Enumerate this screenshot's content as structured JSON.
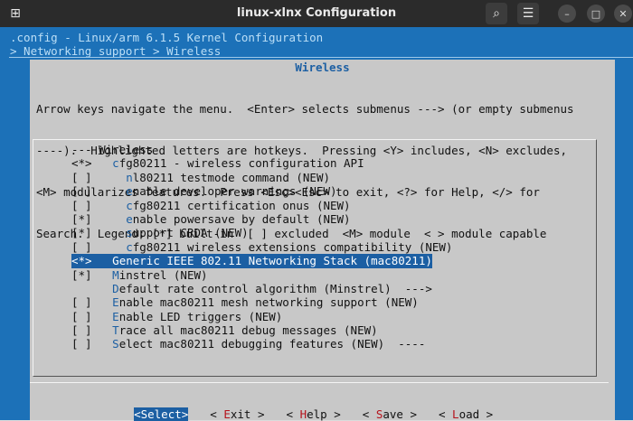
{
  "window": {
    "title": "linux-xlnx Configuration",
    "new_tab_glyph": "⊞",
    "search_glyph": "⌕",
    "menu_glyph": "☰",
    "minimize_glyph": "–",
    "maximize_glyph": "□",
    "close_glyph": "✕"
  },
  "header": {
    "line1": ".config - Linux/arm 6.1.5 Kernel Configuration",
    "line2": "> Networking support > Wireless"
  },
  "dialog": {
    "title": "Wireless",
    "help_lines": [
      "Arrow keys navigate the menu.  <Enter> selects submenus ---> (or empty submenus",
      "----).  Highlighted letters are hotkeys.  Pressing <Y> includes, <N> excludes,",
      "<M> modularizes features.  Press <Esc><Esc> to exit, <?> for Help, </> for",
      "Search.  Legend: [*] built-in  [ ] excluded  <M> module  < > module capable"
    ]
  },
  "menu": {
    "items": [
      {
        "pre": "--- Wireless",
        "hk": "",
        "post": ""
      },
      {
        "pre": "<*>   ",
        "hk": "c",
        "post": "fg80211 - wireless configuration API"
      },
      {
        "pre": "[ ]     ",
        "hk": "n",
        "post": "l80211 testmode command (NEW)"
      },
      {
        "pre": "[ ]     ",
        "hk": "e",
        "post": "nable developer warnings (NEW)"
      },
      {
        "pre": "[ ]     ",
        "hk": "c",
        "post": "fg80211 certification onus (NEW)"
      },
      {
        "pre": "[*]     ",
        "hk": "e",
        "post": "nable powersave by default (NEW)"
      },
      {
        "pre": "[*]     ",
        "hk": "s",
        "post": "upport CRDA (NEW)"
      },
      {
        "pre": "[ ]     ",
        "hk": "c",
        "post": "fg80211 wireless extensions compatibility (NEW)"
      },
      {
        "pre": "<*>   ",
        "hk": "G",
        "post": "eneric IEEE 802.11 Networking Stack (mac80211)"
      },
      {
        "pre": "[*]   ",
        "hk": "M",
        "post": "instrel (NEW)"
      },
      {
        "pre": "      ",
        "hk": "D",
        "post": "efault rate control algorithm (Minstrel)  --->"
      },
      {
        "pre": "[ ]   ",
        "hk": "E",
        "post": "nable mac80211 mesh networking support (NEW)"
      },
      {
        "pre": "[ ]   ",
        "hk": "E",
        "post": "nable LED triggers (NEW)"
      },
      {
        "pre": "[ ]   ",
        "hk": "T",
        "post": "race all mac80211 debug messages (NEW)"
      },
      {
        "pre": "[ ]   ",
        "hk": "S",
        "post": "elect mac80211 debugging features (NEW)  ----"
      }
    ],
    "selected_index": 8
  },
  "buttons": [
    {
      "pre": "<",
      "hk": "S",
      "post": "elect>"
    },
    {
      "pre": "< ",
      "hk": "E",
      "post": "xit >"
    },
    {
      "pre": "< ",
      "hk": "H",
      "post": "elp >"
    },
    {
      "pre": "< ",
      "hk": "S",
      "post": "ave >"
    },
    {
      "pre": "< ",
      "hk": "L",
      "post": "oad >"
    }
  ]
}
